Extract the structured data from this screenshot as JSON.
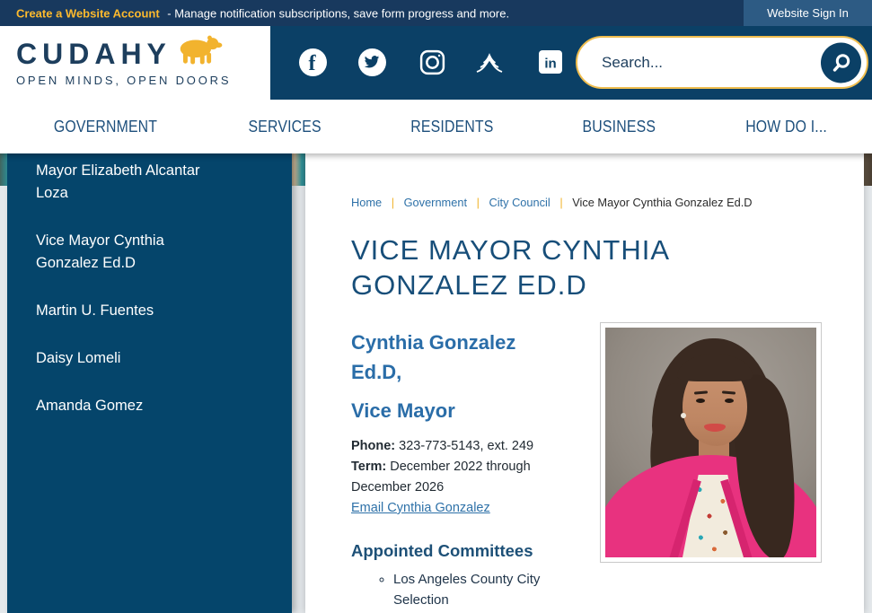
{
  "topbar": {
    "account_link": "Create a Website Account",
    "account_desc": "- Manage notification subscriptions, save form progress and more.",
    "signin_label": "Website Sign In"
  },
  "header": {
    "logo_title": "CUDAHY",
    "logo_tagline": "OPEN MINDS, OPEN DOORS",
    "search_placeholder": "Search...",
    "social_icons": [
      "facebook",
      "twitter",
      "instagram",
      "nextdoor",
      "linkedin"
    ]
  },
  "nav": {
    "items": [
      "GOVERNMENT",
      "SERVICES",
      "RESIDENTS",
      "BUSINESS",
      "HOW DO I..."
    ]
  },
  "sidebar": {
    "items": [
      "Mayor Elizabeth Alcantar Loza",
      "Vice Mayor Cynthia Gonzalez Ed.D",
      "Martin U. Fuentes",
      "Daisy Lomeli",
      "Amanda Gomez"
    ]
  },
  "breadcrumb": {
    "links": [
      "Home",
      "Government",
      "City Council"
    ],
    "separator": "|",
    "current": "Vice Mayor Cynthia Gonzalez Ed.D"
  },
  "main": {
    "page_title": "VICE MAYOR CYNTHIA GONZALEZ ED.D",
    "profile": {
      "name": "Cynthia Gonzalez Ed.D,",
      "role": "Vice Mayor",
      "phone_label": "Phone:",
      "phone_value": "323-773-5143, ext. 249",
      "term_label": "Term:",
      "term_value": "December 2022 through December 2026",
      "email_link": "Email Cynthia Gonzalez"
    },
    "committees": {
      "heading": "Appointed Committees",
      "items": [
        "Los Angeles County City Selection"
      ]
    }
  },
  "colors": {
    "topbar_navy": "#18395E",
    "header_navy": "#0B4066",
    "sidebar_navy": "#05456B",
    "gold": "#F0B42D",
    "link_blue": "#2E71A8",
    "title_navy": "#174E79",
    "blazer_pink": "#E8327F"
  }
}
